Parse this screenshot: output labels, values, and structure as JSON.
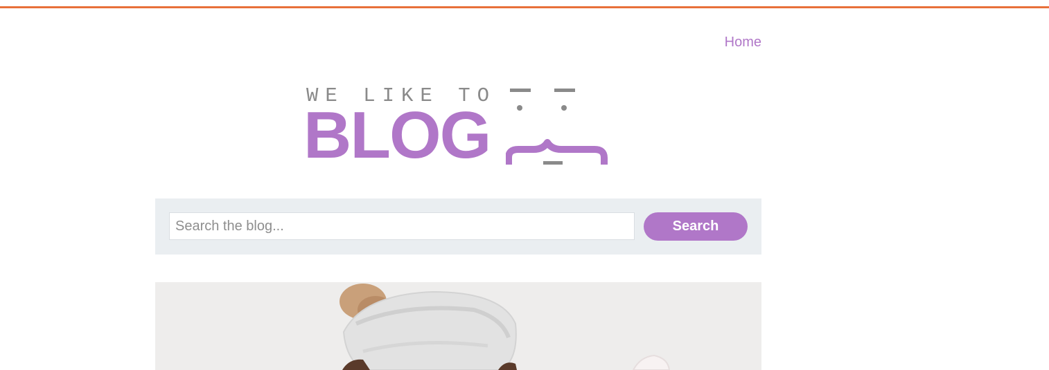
{
  "nav": {
    "home_label": "Home"
  },
  "logo": {
    "tagline": "WE LIKE TO",
    "word": "BLOG"
  },
  "search": {
    "placeholder": "Search the blog...",
    "value": "",
    "button_label": "Search"
  },
  "colors": {
    "accent": "#b077c8",
    "top_bar": "#e8703a",
    "panel": "#eaeef1",
    "logo_gray": "#8a8a8a"
  },
  "hero": {
    "icon": "blog-post-hero-photo"
  }
}
